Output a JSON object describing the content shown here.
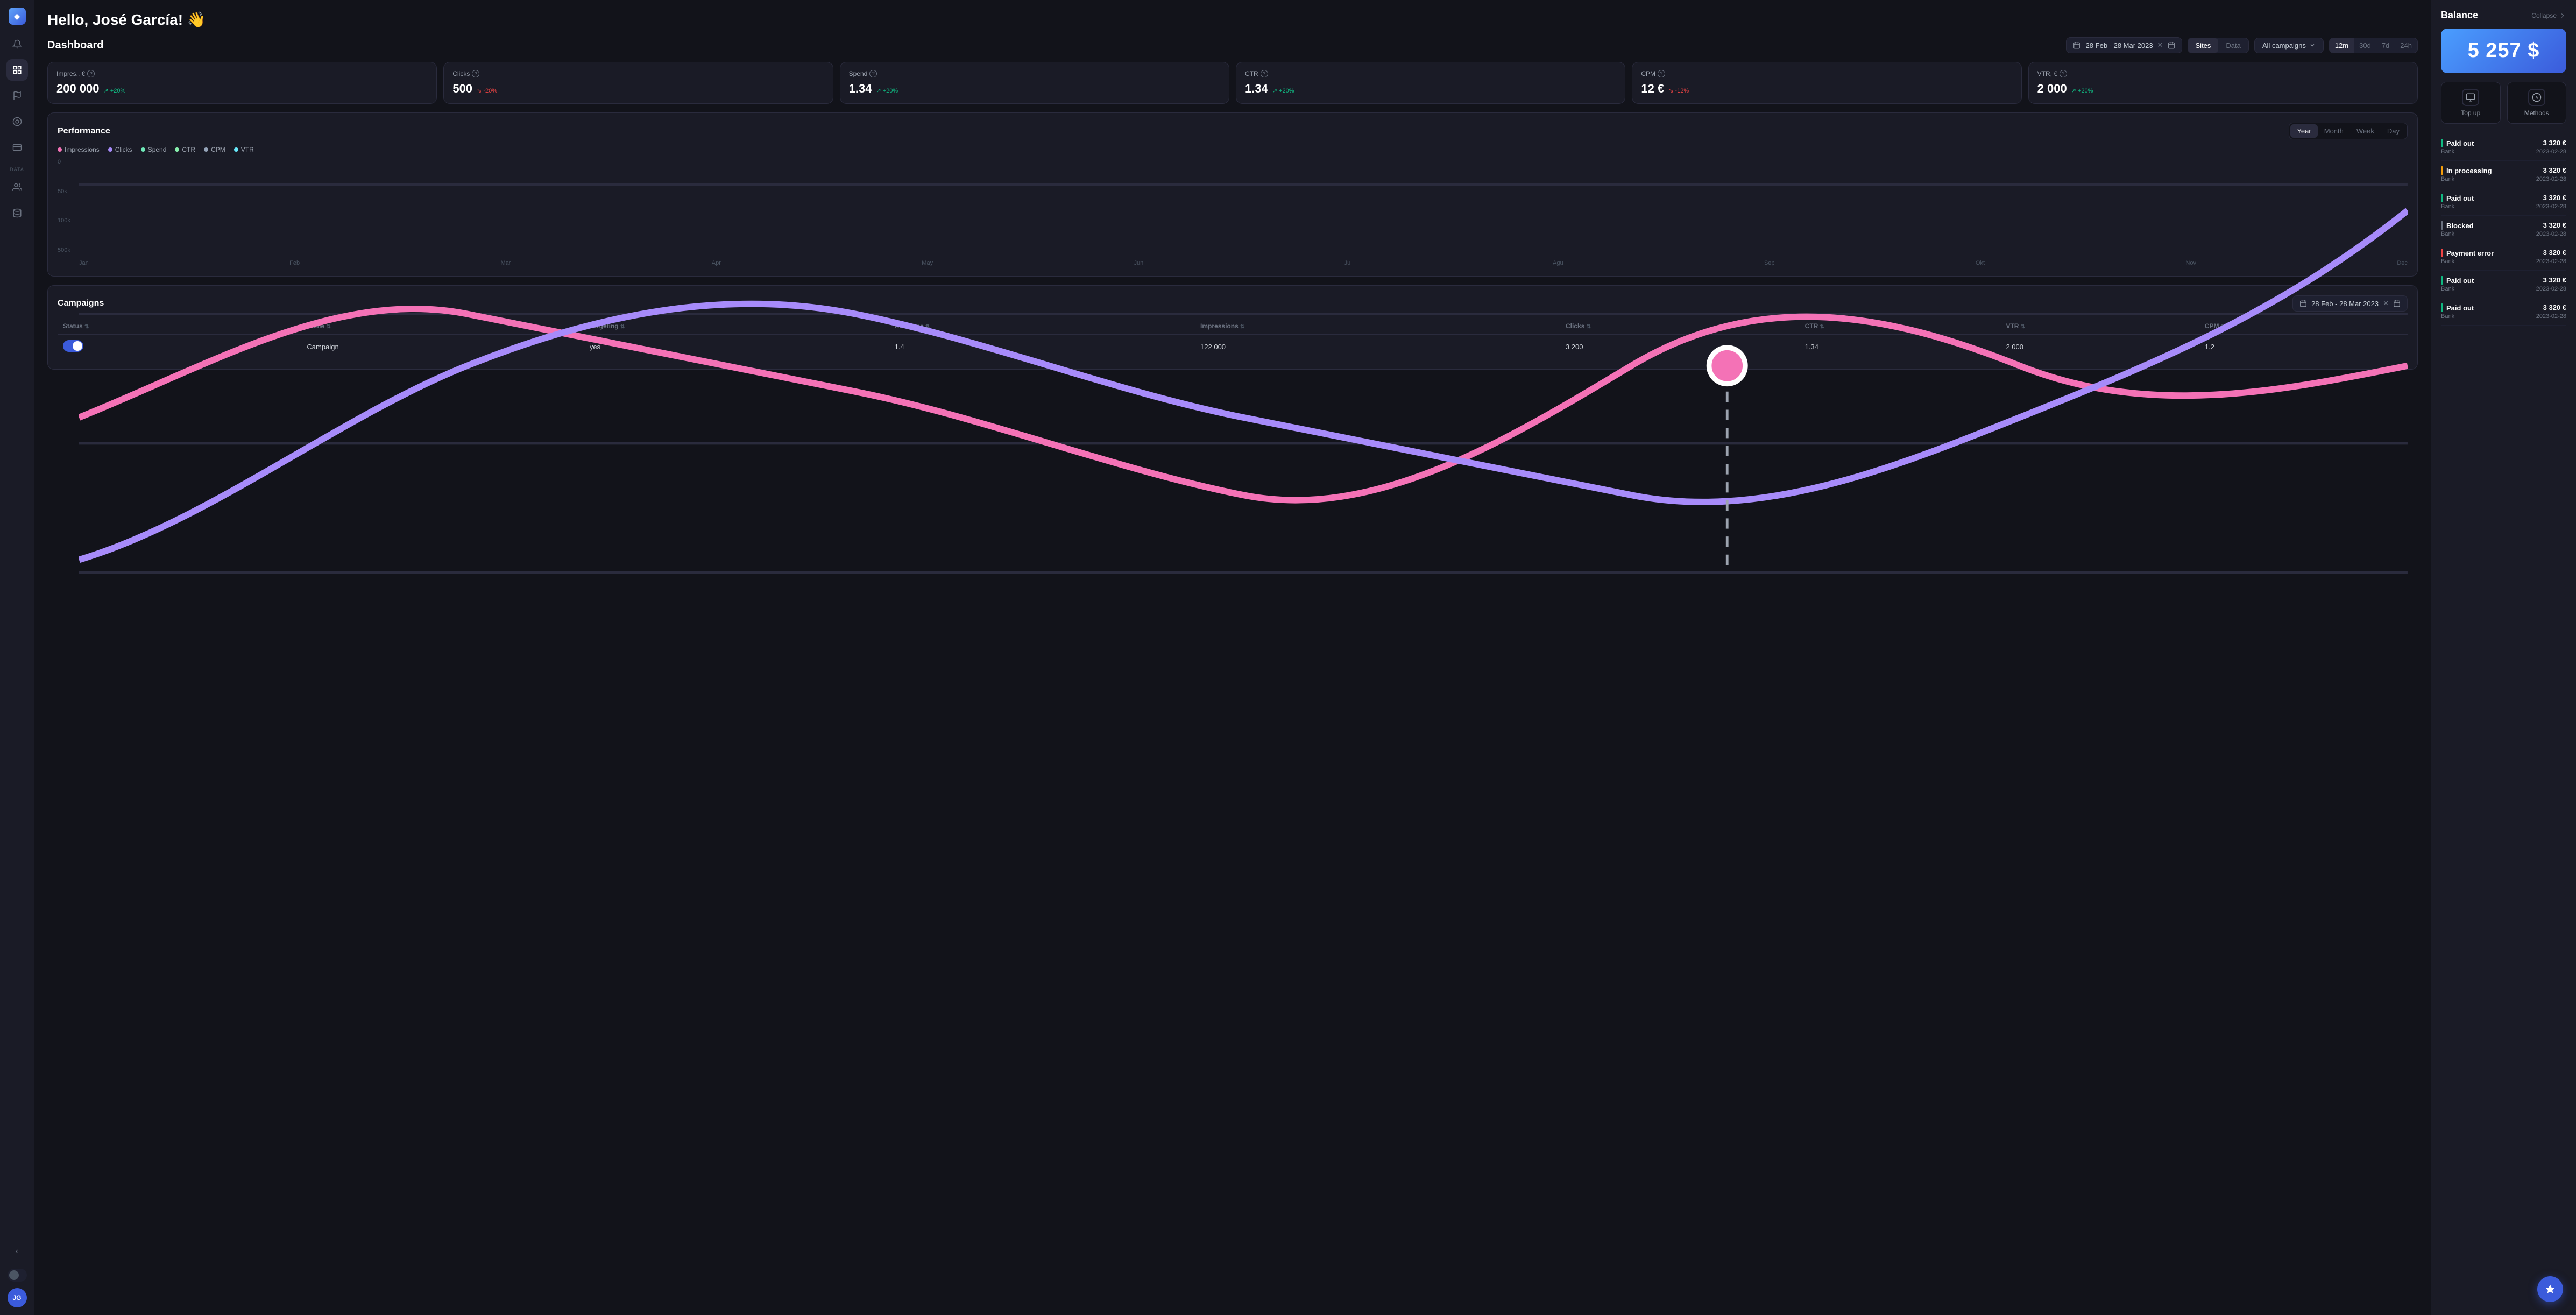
{
  "greeting": "Hello, José García! 👋",
  "sidebar": {
    "logo_icon": "◆",
    "avatar_initials": "JG",
    "items": [
      {
        "id": "bell",
        "icon": "🔔",
        "active": false
      },
      {
        "id": "home",
        "icon": "⊞",
        "active": true
      },
      {
        "id": "flag",
        "icon": "⚑",
        "active": false
      },
      {
        "id": "chart",
        "icon": "◉",
        "active": false
      },
      {
        "id": "card",
        "icon": "▤",
        "active": false
      }
    ],
    "data_label": "DATA",
    "data_items": [
      {
        "id": "users",
        "icon": "👥"
      },
      {
        "id": "db",
        "icon": "▦"
      }
    ],
    "collapse_icon": "‹"
  },
  "dashboard": {
    "title": "Dashboard",
    "date_range": "28 Feb - 28 Mar 2023",
    "view_tabs": [
      {
        "label": "Sites",
        "active": true
      },
      {
        "label": "Data",
        "active": false
      }
    ],
    "campaign_filter": "All campaigns",
    "time_tabs": [
      {
        "label": "12m",
        "active": true
      },
      {
        "label": "30d",
        "active": false
      },
      {
        "label": "7d",
        "active": false
      },
      {
        "label": "24h",
        "active": false
      }
    ]
  },
  "stats": [
    {
      "id": "impressions",
      "label": "Impres., €",
      "value": "200 000",
      "change": "+20%",
      "direction": "up",
      "arrow": "↗"
    },
    {
      "id": "clicks",
      "label": "Clicks",
      "value": "500",
      "change": "-20%",
      "direction": "down",
      "arrow": "↘"
    },
    {
      "id": "spend",
      "label": "Spend",
      "value": "1.34",
      "change": "+20%",
      "direction": "up",
      "arrow": "↗"
    },
    {
      "id": "ctr",
      "label": "CTR",
      "value": "1.34",
      "change": "+20%",
      "direction": "up",
      "arrow": "↗"
    },
    {
      "id": "cpm",
      "label": "CPM",
      "value": "12 €",
      "change": "-12%",
      "direction": "down",
      "arrow": "↘"
    },
    {
      "id": "vtr",
      "label": "VTR, €",
      "value": "2 000",
      "change": "+20%",
      "direction": "up",
      "arrow": "↗"
    }
  ],
  "performance": {
    "title": "Performance",
    "legend": [
      {
        "label": "Impressions",
        "color": "#f472b6"
      },
      {
        "label": "Clicks",
        "color": "#a78bfa"
      },
      {
        "label": "Spend",
        "color": "#6ee7b7"
      },
      {
        "label": "CTR",
        "color": "#86efac"
      },
      {
        "label": "CPM",
        "color": "#94a3b8"
      },
      {
        "label": "VTR",
        "color": "#67e8f9"
      }
    ],
    "period_tabs": [
      {
        "label": "Year",
        "active": true
      },
      {
        "label": "Month",
        "active": false
      },
      {
        "label": "Week",
        "active": false
      },
      {
        "label": "Day",
        "active": false
      }
    ],
    "y_labels": [
      "500k",
      "100k",
      "50k",
      "0"
    ],
    "x_labels": [
      "Jan",
      "Feb",
      "Mar",
      "Apr",
      "May",
      "Jun",
      "Jul",
      "Agu",
      "Sep",
      "Okt",
      "Nov",
      "Dec"
    ]
  },
  "campaigns": {
    "title": "Campaigns",
    "date_range": "28 Feb - 28 Mar 2023",
    "columns": [
      {
        "label": "Status"
      },
      {
        "label": "Name"
      },
      {
        "label": "Targeting"
      },
      {
        "label": "Audience"
      },
      {
        "label": "Impressions"
      },
      {
        "label": "Clicks"
      },
      {
        "label": "CTR"
      },
      {
        "label": "VTR"
      },
      {
        "label": "CPM"
      }
    ],
    "rows": [
      {
        "enabled": true,
        "name": "Campaign",
        "targeting": "yes",
        "audience": "1.4",
        "impressions": "122 000",
        "clicks": "3 200",
        "ctr": "1.34",
        "vtr": "2 000",
        "cpm": "1.2"
      }
    ]
  },
  "balance": {
    "title": "Balance",
    "collapse_label": "Collapse",
    "amount": "5 257 $",
    "actions": [
      {
        "id": "top-up",
        "label": "Top up",
        "icon": "⊕"
      },
      {
        "id": "methods",
        "label": "Methods",
        "icon": "◈"
      }
    ],
    "payments": [
      {
        "status": "Paid out",
        "status_color": "green",
        "amount": "3 320 €",
        "bank": "Bank",
        "date": "2023-02-28"
      },
      {
        "status": "In processing",
        "status_color": "orange",
        "amount": "3 320 €",
        "bank": "Bank",
        "date": "2023-02-28"
      },
      {
        "status": "Paid out",
        "status_color": "green",
        "amount": "3 320 €",
        "bank": "Bank",
        "date": "2023-02-28"
      },
      {
        "status": "Blocked",
        "status_color": "gray",
        "amount": "3 320 €",
        "bank": "Bank",
        "date": "2023-02-28"
      },
      {
        "status": "Payment error",
        "status_color": "red",
        "amount": "3 320 €",
        "bank": "Bank",
        "date": "2023-02-28"
      },
      {
        "status": "Paid out",
        "status_color": "green",
        "amount": "3 320 €",
        "bank": "Bank",
        "date": "2023-02-28"
      },
      {
        "status": "Paid out",
        "status_color": "green",
        "amount": "3 320 €",
        "bank": "Bank",
        "date": "2023-02-28"
      }
    ]
  },
  "fab": {
    "icon": "▼"
  }
}
